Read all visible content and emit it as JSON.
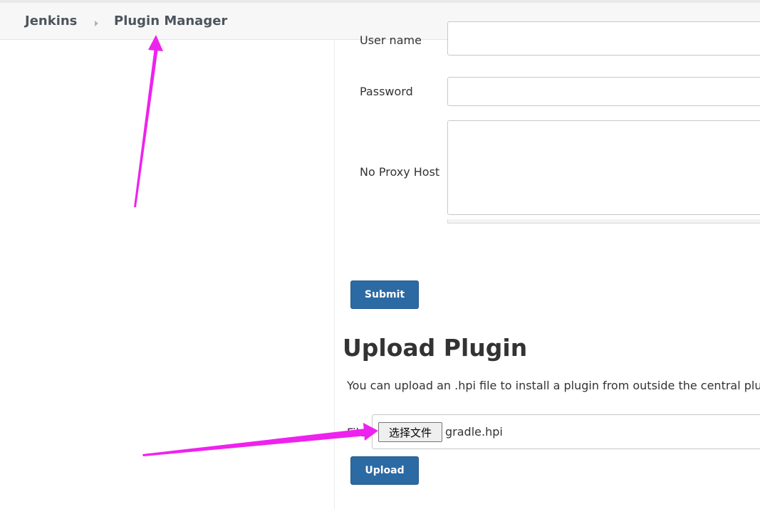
{
  "breadcrumb": {
    "items": [
      {
        "label": "Jenkins"
      },
      {
        "label": "Plugin Manager"
      }
    ]
  },
  "proxy_form": {
    "user_name_label": "User name",
    "user_name_value": "",
    "password_label": "Password",
    "password_value": "",
    "no_proxy_host_label": "No Proxy Host",
    "no_proxy_host_value": "",
    "submit_label": "Submit"
  },
  "upload_plugin": {
    "title": "Upload Plugin",
    "description": "You can upload an .hpi file to install a plugin from outside the central plugin repository.",
    "file_label": "File:",
    "choose_file_label": "选择文件",
    "selected_file": "gradle.hpi",
    "upload_label": "Upload"
  },
  "annotations": {
    "arrow_color": "#ee22ee"
  },
  "colors": {
    "primary_button": "#2c6aa4",
    "breadcrumb_bg": "#f7f7f7",
    "breadcrumb_text": "#4d545d"
  }
}
